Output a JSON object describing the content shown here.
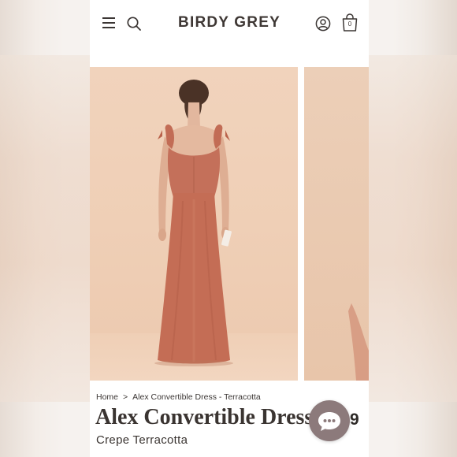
{
  "header": {
    "brand": "BIRDY GREY",
    "menu_icon": "hamburger-menu-icon",
    "search_icon": "search-icon",
    "account_icon": "account-icon",
    "bag_icon": "shopping-bag-icon",
    "bag_count": "0"
  },
  "gallery": {
    "main_image": "back view of model wearing terracotta convertible maxi dress",
    "next_image": "partial preview of next product photo"
  },
  "breadcrumb": {
    "home": "Home",
    "separator": ">",
    "current": "Alex Convertible Dress - Terracotta"
  },
  "product": {
    "title": "Alex Convertible Dress",
    "subtitle": "Crepe Terracotta",
    "price_partial": "9"
  },
  "chat": {
    "icon": "chat-bubble-icon"
  },
  "colors": {
    "brand_text": "#3e3734",
    "dress": "#c46d55",
    "backdrop": "#efcfb6",
    "chat_button": "#8c7a7b"
  }
}
